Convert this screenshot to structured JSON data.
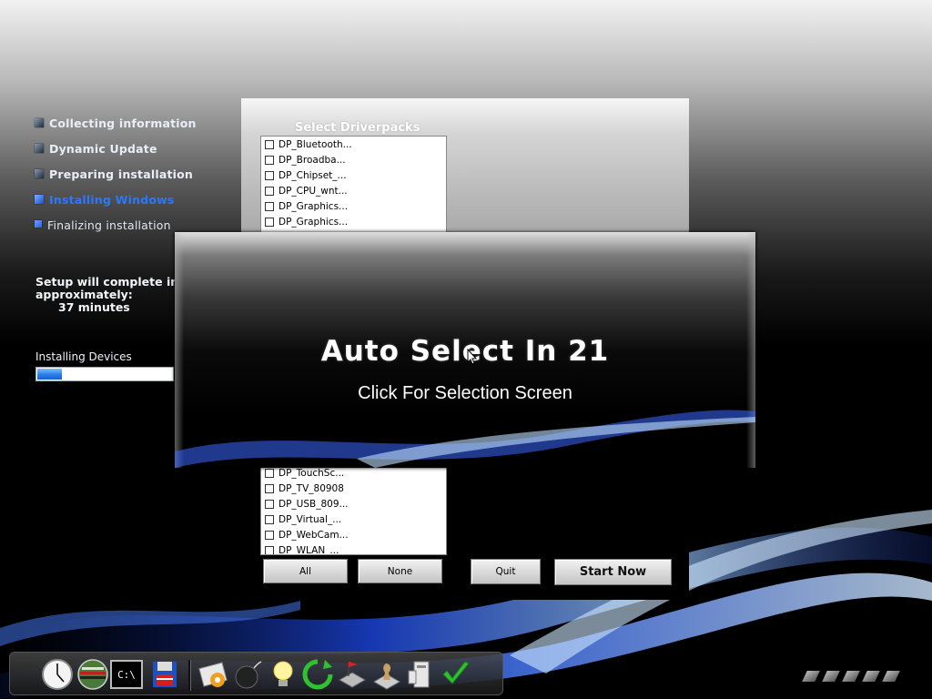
{
  "sidebar": {
    "steps": [
      {
        "label": "Collecting information",
        "state": "done"
      },
      {
        "label": "Dynamic Update",
        "state": "done"
      },
      {
        "label": "Preparing installation",
        "state": "done"
      },
      {
        "label": "Installing Windows",
        "state": "active"
      },
      {
        "label": "Finalizing installation",
        "state": "pending"
      }
    ],
    "time_line1": "Setup will complete in",
    "time_line2": "approximately:",
    "time_line3": "37 minutes",
    "devices_label": "Installing Devices",
    "progress_fraction": 0.18
  },
  "dialog": {
    "title": "Select Driverpacks",
    "top_list": [
      "DP_Bluetooth...",
      "DP_Broadba...",
      "DP_Chipset_...",
      "DP_CPU_wnt...",
      "DP_Graphics...",
      "DP_Graphics..."
    ],
    "bottom_list": [
      "DP_TouchSc...",
      "DP_TV_80908",
      "DP_USB_809...",
      "DP_Virtual_...",
      "DP_WebCam...",
      "DP_WLAN_..."
    ],
    "buttons": {
      "all": "All",
      "none": "None",
      "quit": "Quit",
      "start": "Start Now"
    }
  },
  "overlay": {
    "auto_select": "Auto Select In 21",
    "click_hint": "Click For Selection Screen"
  },
  "taskbar": {
    "icons": [
      "clock-icon",
      "network-icon",
      "command-prompt-icon",
      "floppy-disk-icon",
      "control-panel-icon",
      "bomb-icon",
      "lightbulb-icon",
      "refresh-icon",
      "network-flag-icon",
      "chess-icon",
      "computer-icon",
      "checkmark-icon"
    ],
    "cmd_text": "C:\\"
  },
  "colors": {
    "active_step": "#2a78ff",
    "progress": "#2a7ee8"
  }
}
